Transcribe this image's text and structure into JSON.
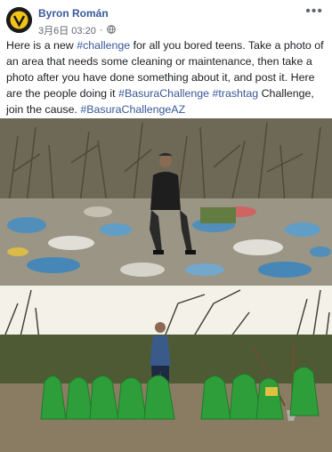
{
  "post": {
    "author": "Byron Román",
    "timestamp": "3月6日 03:20",
    "privacy_icon": "globe-icon",
    "more_icon": "more-options-icon",
    "text": {
      "intro": "Here is a new ",
      "tag_challenge": "#challenge",
      "mid": " for all you bored teens. Take a photo of an area that needs some cleaning or maintenance, then take a photo after you have done something about it, and post it. Here are the people doing it ",
      "tag_basura": "#BasuraChallenge",
      "space": " ",
      "tag_trashtag": "#trashtag",
      "end": " Challenge, join the cause. ",
      "tag_az": "#BasuraChallengeAZ"
    }
  },
  "colors": {
    "link": "#385898",
    "text": "#1c1e21",
    "meta": "#616770",
    "bag_green": "#2e9e3a"
  }
}
